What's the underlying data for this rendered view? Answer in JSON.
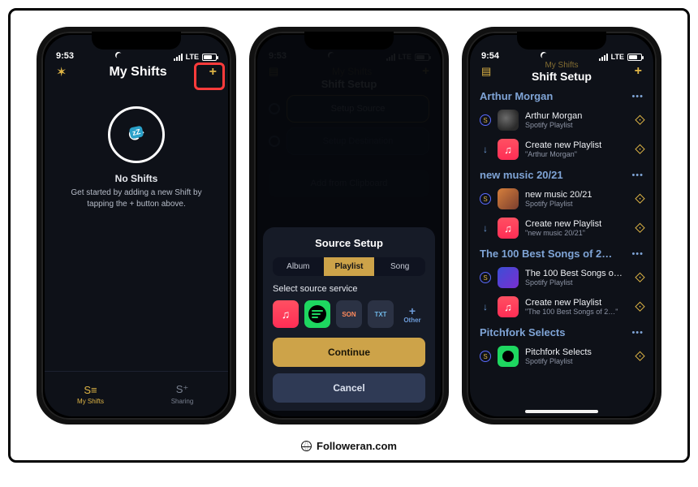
{
  "brand_footer": "Followeran.com",
  "status": {
    "time1": "9:53",
    "time2": "9:53",
    "time3": "9:54",
    "carrier": "LTE"
  },
  "phone1": {
    "title": "My Shifts",
    "empty_title": "No Shifts",
    "empty_sub": "Get started by adding a new Shift by tapping the + button above.",
    "tab1": "My Shifts",
    "tab2": "Sharing",
    "plus": "+",
    "gear": "✶",
    "zz": "zZ"
  },
  "phone2": {
    "title_bg": "My Shifts",
    "subtitle": "Shift Setup",
    "step1": "Setup Source",
    "step2": "Setup Destination",
    "step3": "Add from Clipboard",
    "sheet_title": "Source Setup",
    "seg_album": "Album",
    "seg_playlist": "Playlist",
    "seg_song": "Song",
    "select_label": "Select source service",
    "svc_json": "SON",
    "svc_txt": "TXT",
    "svc_other_plus": "+",
    "svc_other": "Other",
    "continue": "Continue",
    "cancel": "Cancel"
  },
  "phone3": {
    "title_bg": "My Shifts",
    "subtitle": "Shift Setup",
    "groups": [
      {
        "name": "Arthur Morgan",
        "source_title": "Arthur Morgan",
        "source_sub": "Spotify Playlist",
        "dest_title": "Create new Playlist",
        "dest_sub": "\"Arthur Morgan\""
      },
      {
        "name": "new music 20/21",
        "source_title": "new music 20/21",
        "source_sub": "Spotify Playlist",
        "dest_title": "Create new Playlist",
        "dest_sub": "\"new music 20/21\""
      },
      {
        "name": "The 100 Best Songs of 2…",
        "source_title": "The 100 Best Songs o…",
        "source_sub": "Spotify Playlist",
        "dest_title": "Create new Playlist",
        "dest_sub": "\"The 100 Best Songs of 2…\""
      },
      {
        "name": "Pitchfork Selects",
        "source_title": "Pitchfork Selects",
        "source_sub": "Spotify Playlist"
      }
    ],
    "dots": "•••"
  }
}
